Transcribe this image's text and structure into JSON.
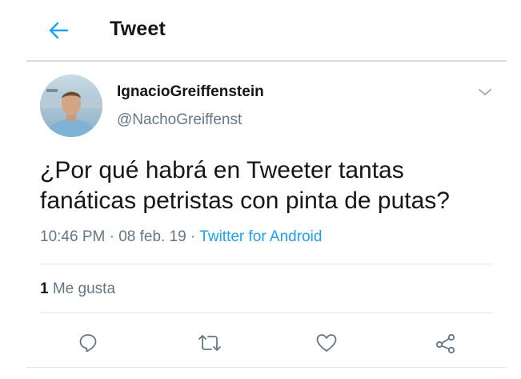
{
  "header": {
    "title": "Tweet",
    "back_icon": "arrow-left-icon",
    "accent_color": "#1da1f2"
  },
  "tweet": {
    "author": {
      "name": "IgnacioGreiffenstein",
      "handle": "@NachoGreiffenst"
    },
    "text_lines": [
      "¿Por qué habrá en Tweeter tantas",
      "fanáticas petristas con pinta de putas?"
    ],
    "time": "10:46 PM",
    "separator": "·",
    "date": "08 feb. 19",
    "source": "Twitter for Android",
    "likes_count": "1",
    "likes_label": "Me gusta"
  },
  "actions": {
    "reply_icon": "reply-icon",
    "retweet_icon": "retweet-icon",
    "like_icon": "heart-icon",
    "share_icon": "share-icon"
  }
}
